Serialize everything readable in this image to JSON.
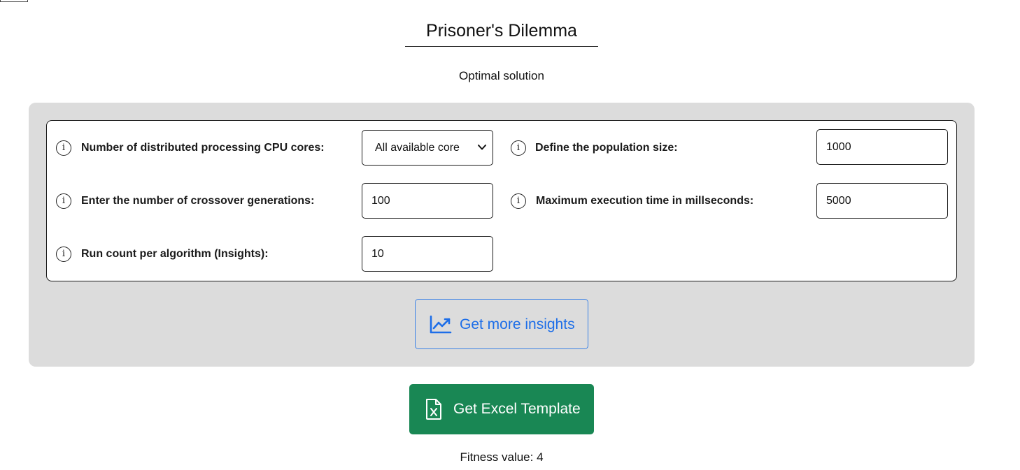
{
  "header": {
    "title": "Prisoner's Dilemma",
    "subtitle": "Optimal solution"
  },
  "form": {
    "cpu_cores": {
      "label": "Number of distributed processing CPU cores:",
      "selected": "All available core",
      "icon": "info-icon"
    },
    "population_size": {
      "label": "Define the population size:",
      "value": "1000",
      "icon": "info-icon"
    },
    "crossover_generations": {
      "label": "Enter the number of crossover generations:",
      "value": "100",
      "icon": "info-icon"
    },
    "max_execution_time": {
      "label": "Maximum execution time in millseconds:",
      "value": "5000",
      "icon": "info-icon"
    },
    "run_count": {
      "label": "Run count per algorithm (Insights):",
      "value": "10",
      "icon": "info-icon"
    }
  },
  "actions": {
    "insights_label": "Get more insights",
    "insights_icon": "line-chart-icon",
    "insights_color": "#1d6ee8",
    "excel_label": "Get Excel Template",
    "excel_icon": "excel-file-icon",
    "excel_color": "#198754"
  },
  "result": {
    "fitness_text": "Fitness value: 4"
  },
  "colors": {
    "panel_bg": "#dcdcdc",
    "form_border": "#1a1a1a"
  }
}
